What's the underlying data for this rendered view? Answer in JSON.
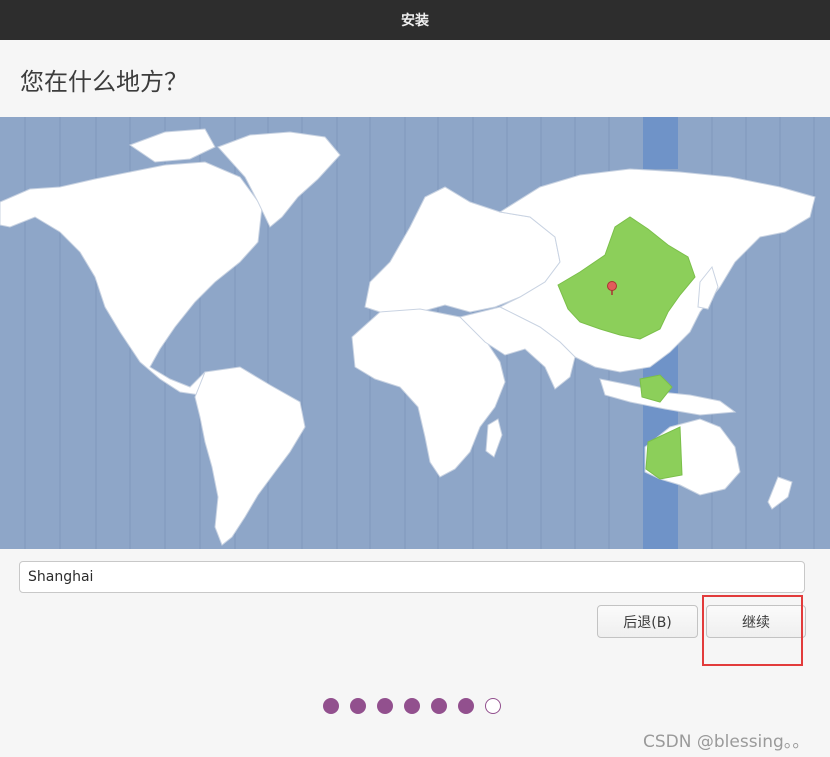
{
  "window": {
    "title": "安装"
  },
  "page": {
    "heading": "您在什么地方？"
  },
  "timezone_map": {
    "selected_city": "Shanghai",
    "colors": {
      "ocean": "#8ea6c8",
      "land": "#ffffff",
      "selected_zone_land": "#8ccf5a",
      "selected_band": "#6f93c8",
      "pin": "#e25b5b"
    }
  },
  "location_input": {
    "value": "Shanghai"
  },
  "buttons": {
    "back_label": "后退(B)",
    "continue_label": "继续"
  },
  "progress": {
    "total_steps": 7,
    "current_step": 7
  },
  "watermark": {
    "text": "CSDN @blessing。。"
  },
  "accent_color": "#92508e",
  "highlight_color": "#e23b3b"
}
